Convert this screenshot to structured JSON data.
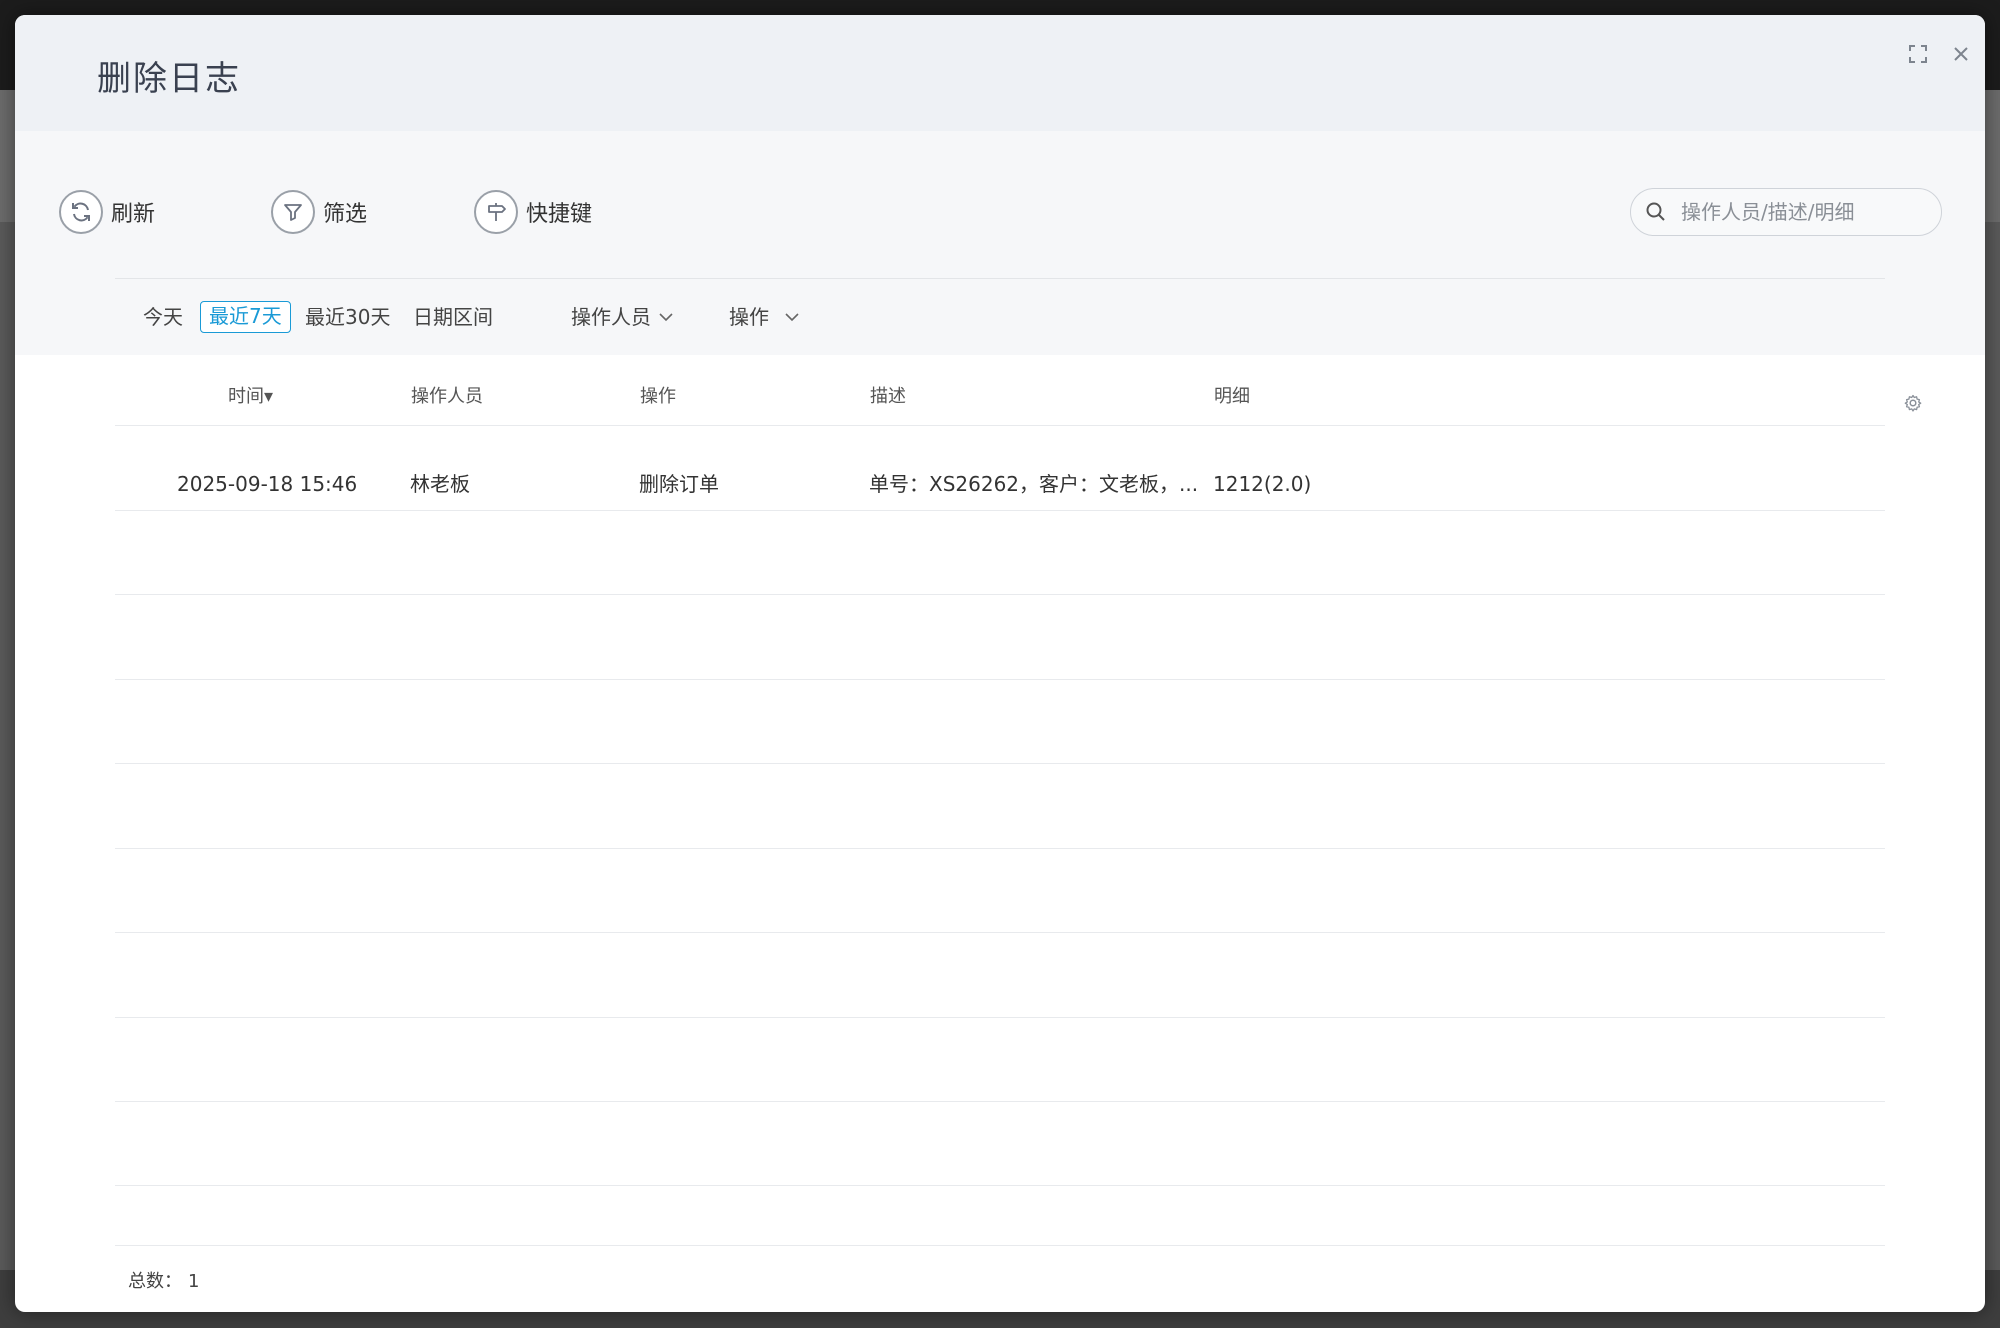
{
  "dialog": {
    "title": "删除日志"
  },
  "toolbar": {
    "refresh_label": "刷新",
    "filter_label": "筛选",
    "shortcut_label": "快捷键"
  },
  "search": {
    "placeholder": "操作人员/描述/明细",
    "value": ""
  },
  "date_filters": {
    "today": "今天",
    "last_7_days": "最近7天",
    "last_30_days": "最近30天",
    "date_range": "日期区间",
    "selected": "最近7天"
  },
  "dropdowns": {
    "operator": "操作人员",
    "operation": "操作"
  },
  "table": {
    "columns": {
      "time": "时间▾",
      "operator": "操作人员",
      "operation": "操作",
      "description": "描述",
      "detail": "明细"
    },
    "rows": [
      {
        "time": "2025-09-18 15:46",
        "operator": "林老板",
        "operation": "删除订单",
        "description": "单号：XS26262，客户：文老板，...",
        "detail": "1212(2.0)"
      }
    ]
  },
  "footer": {
    "total_label": "总数：",
    "total_value": "1"
  },
  "colors": {
    "accent": "#1a9ad6",
    "header_bg": "#eef1f5",
    "toolbar_bg": "#f6f7f9"
  },
  "icons": {
    "refresh": "refresh-icon",
    "filter": "filter-icon",
    "shortcut": "signpost-icon",
    "search": "search-icon",
    "fullscreen": "fullscreen-icon",
    "close": "close-icon",
    "settings": "gear-icon",
    "dropdown": "chevron-down-icon"
  }
}
